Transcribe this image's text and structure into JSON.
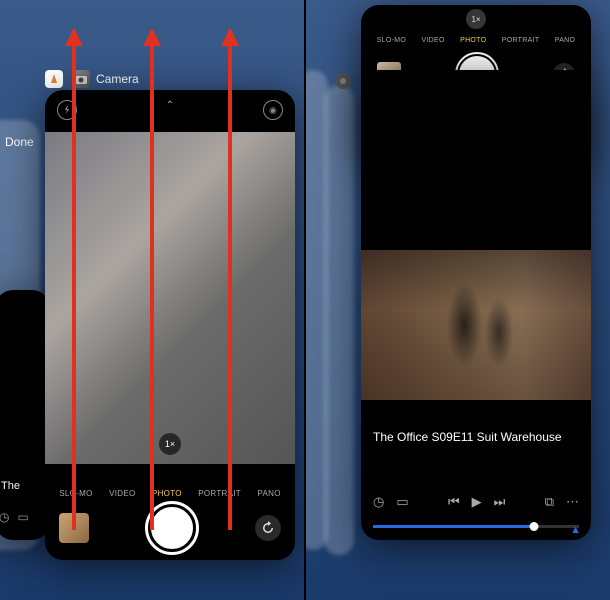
{
  "left": {
    "app_label": "Camera",
    "done_button": "Done",
    "camera_modes": [
      "SLO-MO",
      "VIDEO",
      "PHOTO",
      "PORTRAIT",
      "PANO"
    ],
    "active_mode": "PHOTO",
    "zoom": "1×",
    "player_peek_title": "The",
    "icon_names": {
      "flash": "flash-off-icon",
      "chevron": "chevron-up-icon",
      "live": "live-photo-icon",
      "thumb": "last-photo-thumbnail",
      "shutter": "shutter-button",
      "flip": "flip-camera-icon"
    }
  },
  "right": {
    "camera_modes": [
      "SLO-MO",
      "VIDEO",
      "PHOTO",
      "PORTRAIT",
      "PANO"
    ],
    "active_mode": "PHOTO",
    "zoom": "1×",
    "video_title": "The Office S09E11 Suit Warehouse",
    "progress_percent": 78,
    "controls": {
      "clock": "clock-icon",
      "aspect": "aspect-icon",
      "prev": "skip-back-icon",
      "play": "play-icon",
      "next": "skip-forward-icon",
      "pip": "pip-icon",
      "more": "more-icon",
      "airplay": "airplay-icon"
    }
  }
}
